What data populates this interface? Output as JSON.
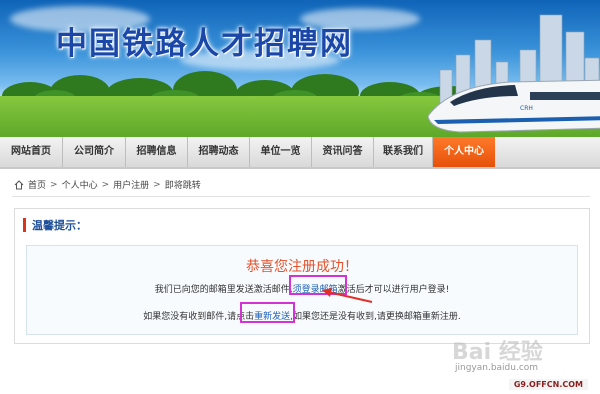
{
  "site": {
    "title": "中国铁路人才招聘网"
  },
  "nav": {
    "items": [
      {
        "label": "网站首页"
      },
      {
        "label": "公司简介"
      },
      {
        "label": "招聘信息"
      },
      {
        "label": "招聘动态"
      },
      {
        "label": "单位一览"
      },
      {
        "label": "资讯问答"
      },
      {
        "label": "联系我们"
      },
      {
        "label": "个人中心",
        "active": true
      }
    ],
    "active_color": "#f26216"
  },
  "breadcrumb": {
    "items": [
      "首页",
      "个人中心",
      "用户注册",
      "即将跳转"
    ],
    "separator": ">"
  },
  "notice": {
    "heading": "温馨提示：",
    "success_message": "恭喜您注册成功！",
    "line1_before": "我们已向您的邮箱里发送激活邮件,",
    "line1_link": "须登录邮箱",
    "line1_after": "激活后才可以进行用户登录!",
    "line2_before": "如果您没有收到邮件,请点击",
    "line2_link": "重新发送",
    "line2_after": ",如果您还是没有收到,请更换邮箱重新注册."
  },
  "watermark": {
    "brand": "Bai 经验",
    "site": "jingyan.baidu.com",
    "stamp": "G9.OFFCN.COM"
  },
  "colors": {
    "accent_red": "#e4532c",
    "link_blue": "#1f5fb5",
    "highlight_magenta": "#d233d2"
  }
}
